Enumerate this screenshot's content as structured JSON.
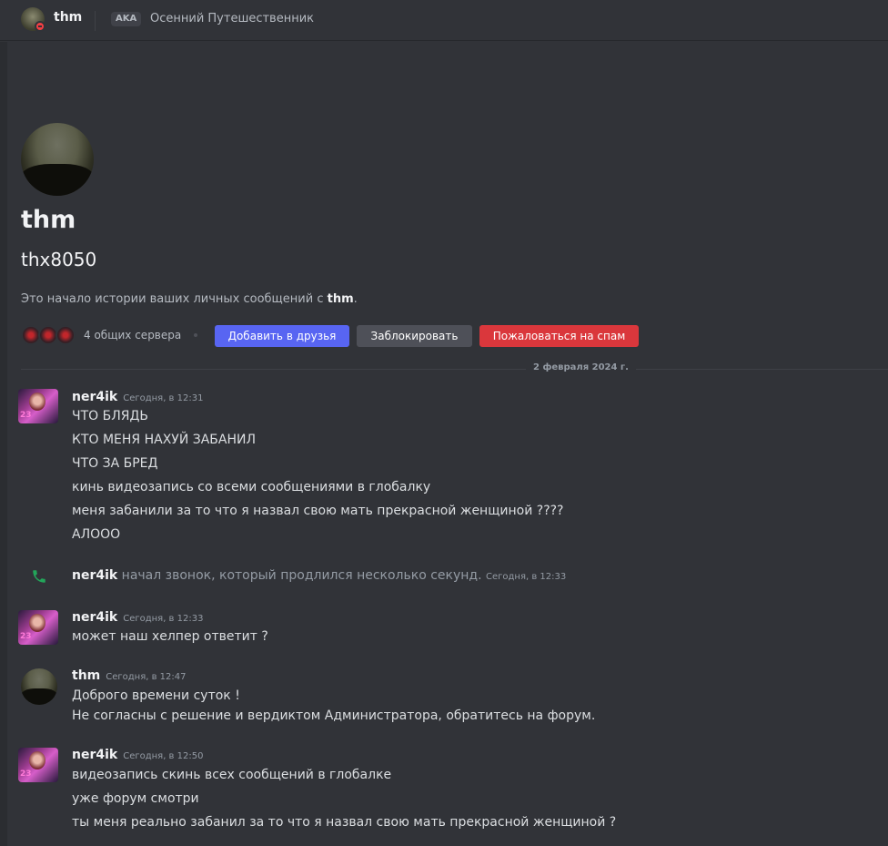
{
  "header": {
    "name": "thm",
    "aka_badge": "AKA",
    "aka_name": "Осенний Путешественник"
  },
  "profile": {
    "name": "thm",
    "username": "thx8050",
    "intro_prefix": "Это начало истории ваших личных сообщений с ",
    "intro_name": "thm",
    "intro_suffix": ".",
    "mutual_servers": "4 общих сервера",
    "buttons": {
      "add_friend": "Добавить в друзья",
      "block": "Заблокировать",
      "report_spam": "Пожаловаться на спам"
    }
  },
  "date_divider": "2 февраля 2024 г.",
  "messages": [
    {
      "author": "ner4ik",
      "timestamp": "Сегодня, в 12:31",
      "lines": [
        "ЧТО БЛЯДЬ",
        "КТО МЕНЯ НАХУЙ ЗАБАНИЛ",
        "ЧТО ЗА БРЕД",
        "кинь видеозапись со всеми сообщениями в глобалку",
        "меня забанили за то что я назвал свою мать прекрасной женщиной ????",
        "АЛООО"
      ]
    },
    {
      "call": true,
      "author": "ner4ik",
      "text": " начал звонок, который продлился несколько секунд. ",
      "timestamp": "Сегодня, в 12:33"
    },
    {
      "author": "ner4ik",
      "timestamp": "Сегодня, в 12:33",
      "lines": [
        "может наш хелпер ответит ?"
      ]
    },
    {
      "author": "thm",
      "timestamp": "Сегодня, в 12:47",
      "lines": [
        "Доброго времени суток !",
        "Не согласны с решение и вердиктом Администратора, обратитесь на форум."
      ]
    },
    {
      "author": "ner4ik",
      "timestamp": "Сегодня, в 12:50",
      "lines": [
        "видеозапись скинь всех сообщений в глобалке",
        "уже форум смотри",
        "ты меня реально забанил за то что я назвал свою мать прекрасной женщиной ?"
      ]
    }
  ],
  "icons": {
    "status": "do-not-disturb-icon",
    "call": "phone-icon",
    "accent": "#5865f2",
    "danger": "#da373c",
    "call_color": "#23a55a"
  }
}
